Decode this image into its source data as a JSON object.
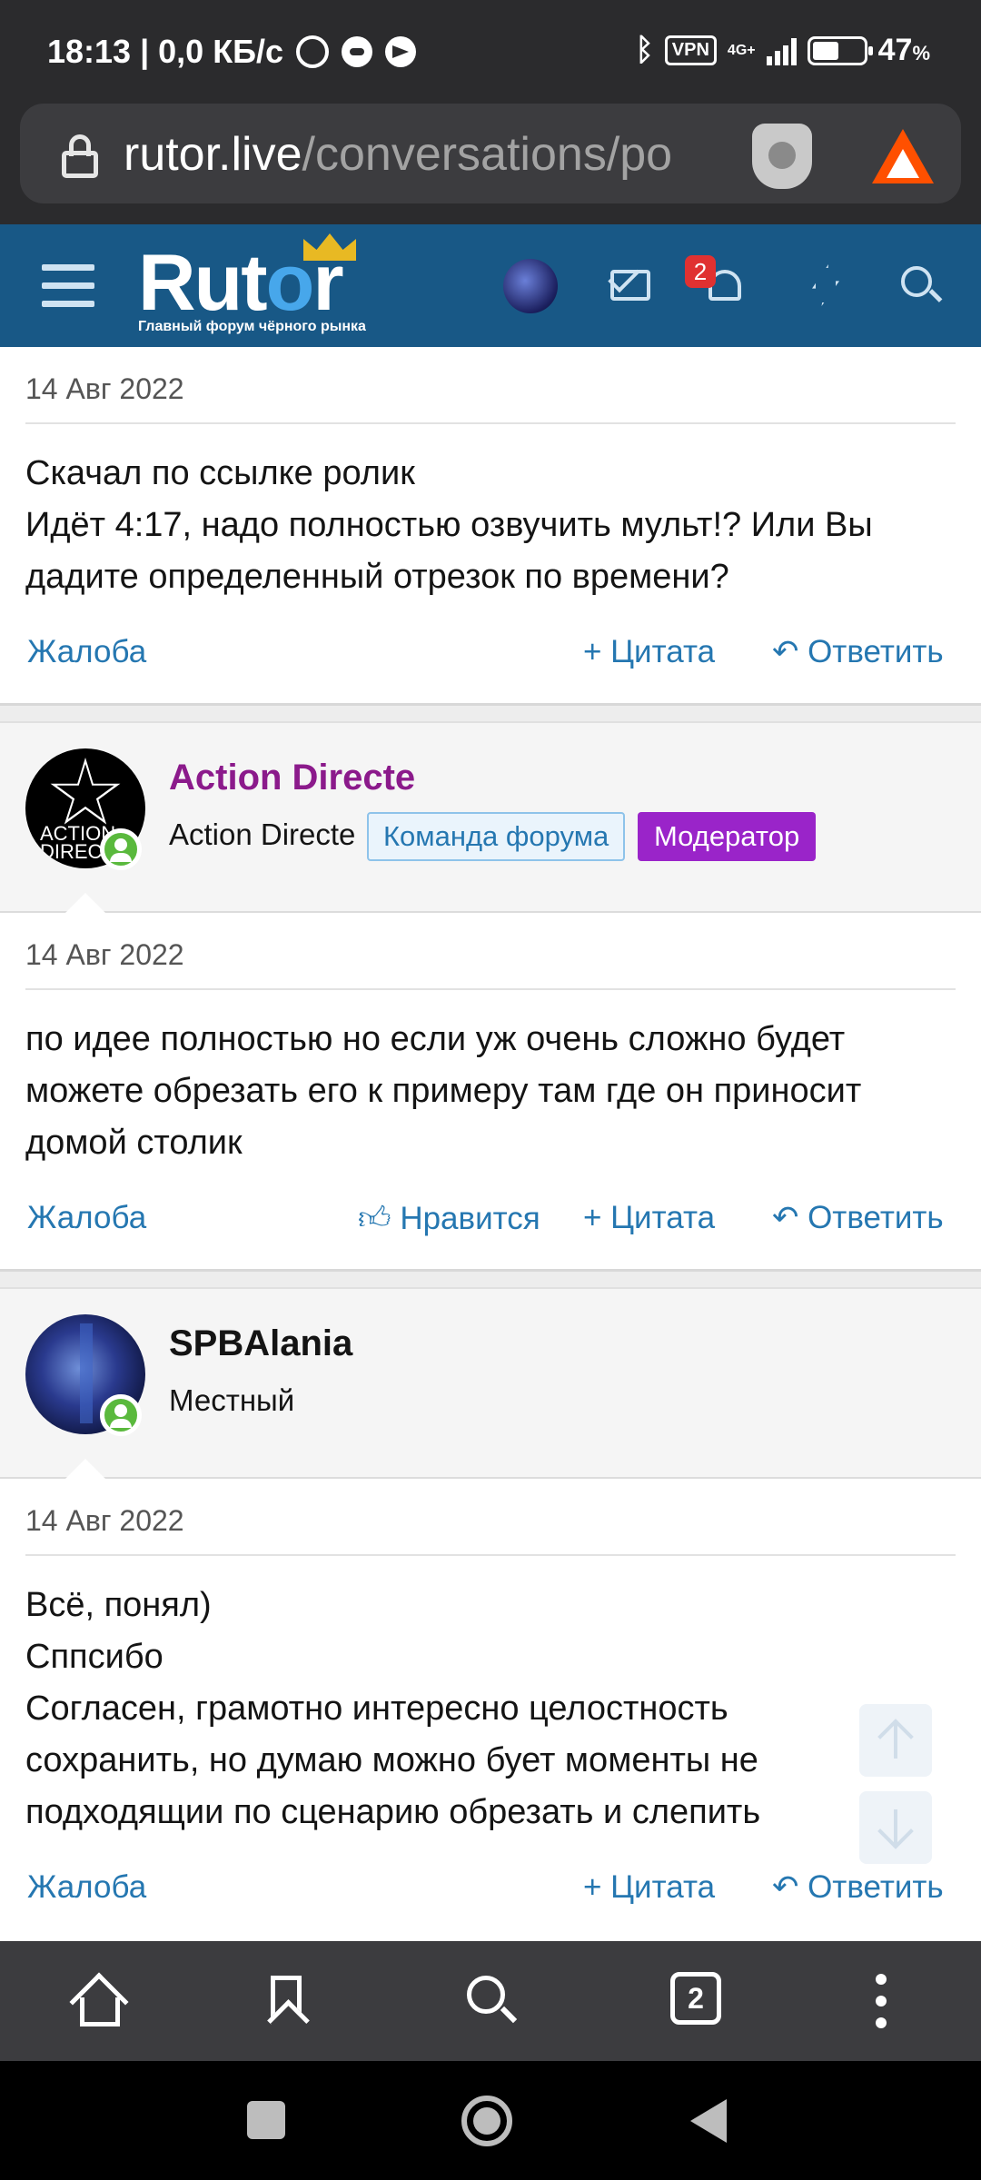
{
  "status_bar": {
    "time_speed": "18:13 | 0,0 КБ/с",
    "vpn": "VPN",
    "network": "4G+",
    "battery": "47",
    "battery_unit": "%"
  },
  "browser": {
    "url_domain": "rutor.live",
    "url_path": "/conversations/po",
    "tabs_count": "2"
  },
  "site_header": {
    "logo_text_a": "Rut",
    "logo_text_b": "o",
    "logo_text_c": "r",
    "logo_tagline": "Главный форум чёрного рынка",
    "notification_count": "2"
  },
  "posts": [
    {
      "date": "14 Авг 2022",
      "lines": [
        "Скачал по ссылке ролик",
        "Идёт 4:17, надо полностью озвучить мульт!? Или Вы дадите определенный отрезок по времени?"
      ],
      "actions": {
        "report": "Жалоба",
        "quote": "+ Цитата",
        "reply": "Ответить"
      }
    },
    {
      "author": {
        "name": "Action Directe",
        "title": "Action Directe",
        "tag_team": "Команда форума",
        "tag_mod": "Модератор",
        "avatar_text": "ACTION DIREC"
      },
      "date": "14 Авг 2022",
      "lines": [
        "по идее полностью но если уж очень сложно будет можете обрезать его к примеру там где он приносит домой столик"
      ],
      "actions": {
        "report": "Жалоба",
        "like": "Нравится",
        "quote": "+ Цитата",
        "reply": "Ответить"
      }
    },
    {
      "author": {
        "name": "SPBAlania",
        "title": "Местный"
      },
      "date": "14 Авг 2022",
      "lines": [
        "Всё, понял)",
        "Сппсибо",
        "Согласен, грамотно интересно целостность сохранить, но думаю можно бует моменты не подходящии по сценарию обрезать и слепить"
      ],
      "actions": {
        "report": "Жалоба",
        "quote": "+ Цитата",
        "reply": "Ответить"
      }
    }
  ],
  "colors": {
    "header_bg": "#185886",
    "link": "#2577b1",
    "mod_name": "#8b1a8b",
    "mod_badge": "#9a24c9",
    "online": "#5ab93d"
  }
}
